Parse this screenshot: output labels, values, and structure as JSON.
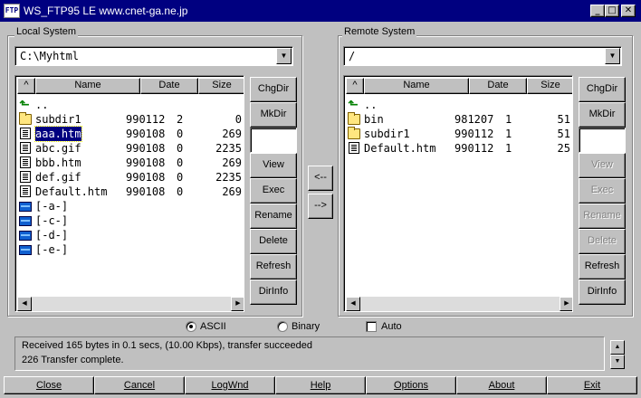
{
  "window": {
    "icon": "FTP",
    "title": "WS_FTP95 LE www.cnet-ga.ne.jp"
  },
  "window_controls": {
    "minimize_icon": "minimize-icon",
    "maximize_icon": "maximize-icon",
    "close_icon": "close-icon"
  },
  "local": {
    "group_label": "Local System",
    "path": "C:\\Myhtml",
    "columns": {
      "sort": "^",
      "name": "Name",
      "date": "Date",
      "size": "Size"
    },
    "files": [
      {
        "icon": "up-arrow-icon",
        "name": "..",
        "date": "",
        "attr": "",
        "size": ""
      },
      {
        "icon": "folder-icon",
        "name": "subdir1",
        "date": "990112",
        "attr": "2",
        "size": "0"
      },
      {
        "icon": "file-icon",
        "name": "aaa.htm",
        "date": "990108",
        "attr": "0",
        "size": "269"
      },
      {
        "icon": "file-icon",
        "name": "abc.gif",
        "date": "990108",
        "attr": "0",
        "size": "2235"
      },
      {
        "icon": "file-icon",
        "name": "bbb.htm",
        "date": "990108",
        "attr": "0",
        "size": "269"
      },
      {
        "icon": "file-icon",
        "name": "def.gif",
        "date": "990108",
        "attr": "0",
        "size": "2235"
      },
      {
        "icon": "file-icon",
        "name": "Default.htm",
        "date": "990108",
        "attr": "0",
        "size": "269"
      },
      {
        "icon": "drive-icon",
        "name": "[-a-]",
        "date": "",
        "attr": "",
        "size": ""
      },
      {
        "icon": "drive-icon",
        "name": "[-c-]",
        "date": "",
        "attr": "",
        "size": ""
      },
      {
        "icon": "drive-icon",
        "name": "[-d-]",
        "date": "",
        "attr": "",
        "size": ""
      },
      {
        "icon": "drive-icon",
        "name": "[-e-]",
        "date": "",
        "attr": "",
        "size": ""
      }
    ],
    "selected_index": 2,
    "buttons": {
      "chgdir": "ChgDir",
      "mkdir": "MkDir",
      "view": "View",
      "exec": "Exec",
      "rename": "Rename",
      "delete": "Delete",
      "refresh": "Refresh",
      "dirinfo": "DirInfo"
    }
  },
  "remote": {
    "group_label": "Remote System",
    "path": "/",
    "columns": {
      "sort": "^",
      "name": "Name",
      "date": "Date",
      "size": "Size"
    },
    "files": [
      {
        "icon": "up-arrow-icon",
        "name": "..",
        "date": "",
        "attr": "",
        "size": ""
      },
      {
        "icon": "folder-icon",
        "name": "bin",
        "date": "981207",
        "attr": "1",
        "size": "51"
      },
      {
        "icon": "folder-icon",
        "name": "subdir1",
        "date": "990112",
        "attr": "1",
        "size": "51"
      },
      {
        "icon": "file-icon",
        "name": "Default.htm",
        "date": "990112",
        "attr": "1",
        "size": "25"
      }
    ],
    "buttons": {
      "chgdir": "ChgDir",
      "mkdir": "MkDir",
      "view": "View",
      "exec": "Exec",
      "rename": "Rename",
      "delete": "Delete",
      "refresh": "Refresh",
      "dirinfo": "DirInfo"
    }
  },
  "transfer": {
    "to_local": "<--",
    "to_remote": "-->"
  },
  "mode": {
    "ascii": "ASCII",
    "binary": "Binary",
    "auto": "Auto",
    "selected": "ASCII",
    "auto_checked": false
  },
  "status": {
    "line1": "Received 165 bytes in 0.1 secs, (10.00 Kbps), transfer succeeded",
    "line2": "226 Transfer complete."
  },
  "bottom_buttons": {
    "close": "Close",
    "cancel": "Cancel",
    "logwnd": "LogWnd",
    "help": "Help",
    "options": "Options",
    "about": "About",
    "exit": "Exit"
  }
}
